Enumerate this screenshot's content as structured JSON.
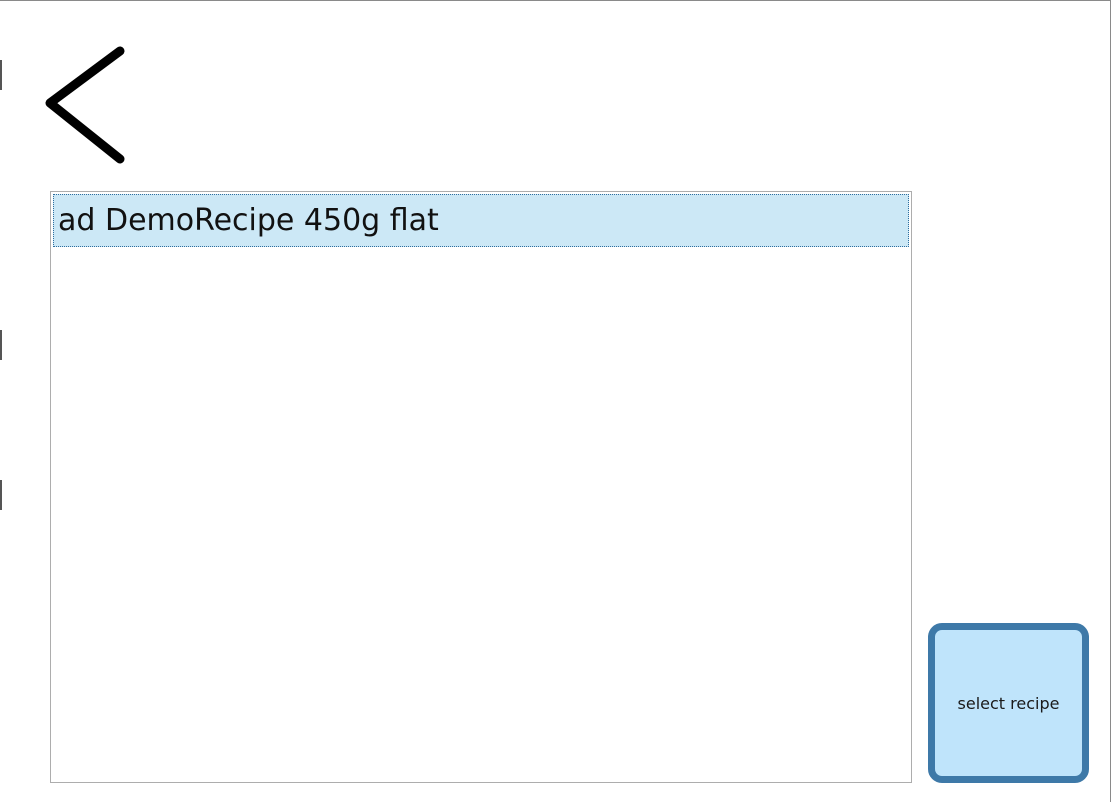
{
  "header": {
    "back_icon": "chevron-left-icon"
  },
  "recipe_list": {
    "items": [
      {
        "label": "ad DemoRecipe 450g flat",
        "selected": true
      }
    ]
  },
  "actions": {
    "select_label": "select recipe"
  },
  "colors": {
    "selection_background": "#cce8f6",
    "button_background": "#bfe4fb",
    "button_border": "#3e79a8"
  }
}
